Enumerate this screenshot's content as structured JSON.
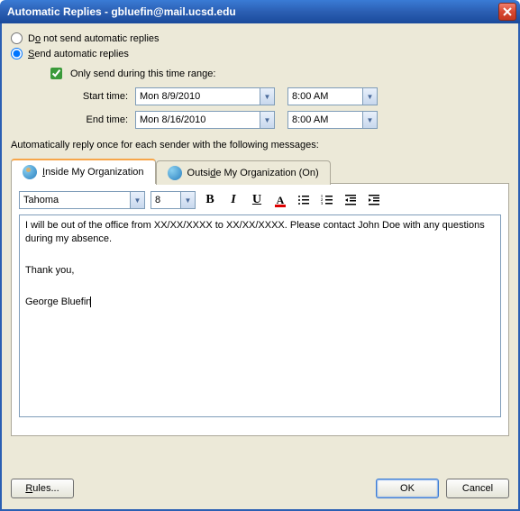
{
  "title": "Automatic Replies - gbluefin@mail.ucsd.edu",
  "options": {
    "do_not_send": "Do not send automatic replies",
    "send": "Send automatic replies",
    "only_range": "Only send during this time range:",
    "start_label": "Start time:",
    "end_label": "End time:",
    "start_date": "Mon 8/9/2010",
    "end_date": "Mon 8/16/2010",
    "start_time": "8:00 AM",
    "end_time": "8:00 AM"
  },
  "section_label": "Automatically reply once for each sender with the following messages:",
  "tabs": {
    "inside": "Inside My Organization",
    "outside": "Outside My Organization (On)"
  },
  "editor": {
    "font_name": "Tahoma",
    "font_size": "8",
    "body_line1": "I will be out of the office from XX/XX/XXXX to XX/XX/XXXX.  Please contact John Doe with any questions during my absence.",
    "body_line2": "Thank you,",
    "body_line3": "George Bluefin"
  },
  "buttons": {
    "rules": "Rules...",
    "ok": "OK",
    "cancel": "Cancel"
  }
}
